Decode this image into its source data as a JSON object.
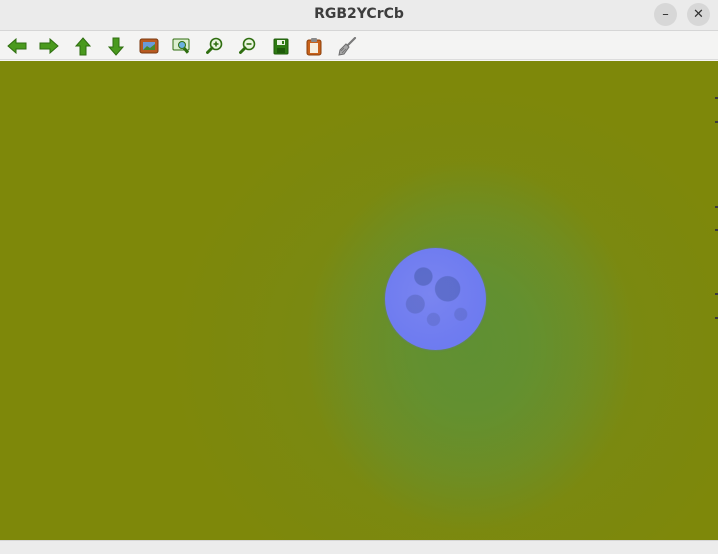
{
  "window": {
    "title": "RGB2YCrCb",
    "minimize_label": "–",
    "close_label": "✕"
  },
  "toolbar": {
    "items": [
      {
        "name": "back",
        "icon": "arrow-left-icon"
      },
      {
        "name": "forward",
        "icon": "arrow-right-icon"
      },
      {
        "name": "up",
        "icon": "arrow-up-icon"
      },
      {
        "name": "down",
        "icon": "arrow-down-icon"
      },
      {
        "name": "image",
        "icon": "image-icon"
      },
      {
        "name": "fit-view",
        "icon": "zoom-fit-icon"
      },
      {
        "name": "zoom-in",
        "icon": "zoom-in-icon"
      },
      {
        "name": "zoom-out",
        "icon": "zoom-out-icon"
      },
      {
        "name": "save",
        "icon": "save-icon"
      },
      {
        "name": "clipboard",
        "icon": "clipboard-icon"
      },
      {
        "name": "clear",
        "icon": "broom-icon"
      }
    ]
  },
  "colors": {
    "canvas_background": "#808508",
    "canvas_glow": "#4f9440",
    "moon": "#6f7cf0",
    "toolbar_icon_green": "#3e8e1a",
    "save_icon_green": "#2d7a12",
    "clipboard_orange": "#c8621a"
  }
}
